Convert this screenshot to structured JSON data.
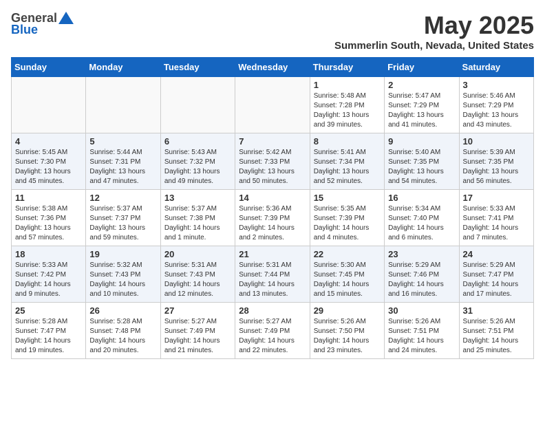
{
  "logo": {
    "general": "General",
    "blue": "Blue"
  },
  "title": "May 2025",
  "subtitle": "Summerlin South, Nevada, United States",
  "headers": [
    "Sunday",
    "Monday",
    "Tuesday",
    "Wednesday",
    "Thursday",
    "Friday",
    "Saturday"
  ],
  "weeks": [
    [
      {
        "day": "",
        "info": ""
      },
      {
        "day": "",
        "info": ""
      },
      {
        "day": "",
        "info": ""
      },
      {
        "day": "",
        "info": ""
      },
      {
        "day": "1",
        "info": "Sunrise: 5:48 AM\nSunset: 7:28 PM\nDaylight: 13 hours\nand 39 minutes."
      },
      {
        "day": "2",
        "info": "Sunrise: 5:47 AM\nSunset: 7:29 PM\nDaylight: 13 hours\nand 41 minutes."
      },
      {
        "day": "3",
        "info": "Sunrise: 5:46 AM\nSunset: 7:29 PM\nDaylight: 13 hours\nand 43 minutes."
      }
    ],
    [
      {
        "day": "4",
        "info": "Sunrise: 5:45 AM\nSunset: 7:30 PM\nDaylight: 13 hours\nand 45 minutes."
      },
      {
        "day": "5",
        "info": "Sunrise: 5:44 AM\nSunset: 7:31 PM\nDaylight: 13 hours\nand 47 minutes."
      },
      {
        "day": "6",
        "info": "Sunrise: 5:43 AM\nSunset: 7:32 PM\nDaylight: 13 hours\nand 49 minutes."
      },
      {
        "day": "7",
        "info": "Sunrise: 5:42 AM\nSunset: 7:33 PM\nDaylight: 13 hours\nand 50 minutes."
      },
      {
        "day": "8",
        "info": "Sunrise: 5:41 AM\nSunset: 7:34 PM\nDaylight: 13 hours\nand 52 minutes."
      },
      {
        "day": "9",
        "info": "Sunrise: 5:40 AM\nSunset: 7:35 PM\nDaylight: 13 hours\nand 54 minutes."
      },
      {
        "day": "10",
        "info": "Sunrise: 5:39 AM\nSunset: 7:35 PM\nDaylight: 13 hours\nand 56 minutes."
      }
    ],
    [
      {
        "day": "11",
        "info": "Sunrise: 5:38 AM\nSunset: 7:36 PM\nDaylight: 13 hours\nand 57 minutes."
      },
      {
        "day": "12",
        "info": "Sunrise: 5:37 AM\nSunset: 7:37 PM\nDaylight: 13 hours\nand 59 minutes."
      },
      {
        "day": "13",
        "info": "Sunrise: 5:37 AM\nSunset: 7:38 PM\nDaylight: 14 hours\nand 1 minute."
      },
      {
        "day": "14",
        "info": "Sunrise: 5:36 AM\nSunset: 7:39 PM\nDaylight: 14 hours\nand 2 minutes."
      },
      {
        "day": "15",
        "info": "Sunrise: 5:35 AM\nSunset: 7:39 PM\nDaylight: 14 hours\nand 4 minutes."
      },
      {
        "day": "16",
        "info": "Sunrise: 5:34 AM\nSunset: 7:40 PM\nDaylight: 14 hours\nand 6 minutes."
      },
      {
        "day": "17",
        "info": "Sunrise: 5:33 AM\nSunset: 7:41 PM\nDaylight: 14 hours\nand 7 minutes."
      }
    ],
    [
      {
        "day": "18",
        "info": "Sunrise: 5:33 AM\nSunset: 7:42 PM\nDaylight: 14 hours\nand 9 minutes."
      },
      {
        "day": "19",
        "info": "Sunrise: 5:32 AM\nSunset: 7:43 PM\nDaylight: 14 hours\nand 10 minutes."
      },
      {
        "day": "20",
        "info": "Sunrise: 5:31 AM\nSunset: 7:43 PM\nDaylight: 14 hours\nand 12 minutes."
      },
      {
        "day": "21",
        "info": "Sunrise: 5:31 AM\nSunset: 7:44 PM\nDaylight: 14 hours\nand 13 minutes."
      },
      {
        "day": "22",
        "info": "Sunrise: 5:30 AM\nSunset: 7:45 PM\nDaylight: 14 hours\nand 15 minutes."
      },
      {
        "day": "23",
        "info": "Sunrise: 5:29 AM\nSunset: 7:46 PM\nDaylight: 14 hours\nand 16 minutes."
      },
      {
        "day": "24",
        "info": "Sunrise: 5:29 AM\nSunset: 7:47 PM\nDaylight: 14 hours\nand 17 minutes."
      }
    ],
    [
      {
        "day": "25",
        "info": "Sunrise: 5:28 AM\nSunset: 7:47 PM\nDaylight: 14 hours\nand 19 minutes."
      },
      {
        "day": "26",
        "info": "Sunrise: 5:28 AM\nSunset: 7:48 PM\nDaylight: 14 hours\nand 20 minutes."
      },
      {
        "day": "27",
        "info": "Sunrise: 5:27 AM\nSunset: 7:49 PM\nDaylight: 14 hours\nand 21 minutes."
      },
      {
        "day": "28",
        "info": "Sunrise: 5:27 AM\nSunset: 7:49 PM\nDaylight: 14 hours\nand 22 minutes."
      },
      {
        "day": "29",
        "info": "Sunrise: 5:26 AM\nSunset: 7:50 PM\nDaylight: 14 hours\nand 23 minutes."
      },
      {
        "day": "30",
        "info": "Sunrise: 5:26 AM\nSunset: 7:51 PM\nDaylight: 14 hours\nand 24 minutes."
      },
      {
        "day": "31",
        "info": "Sunrise: 5:26 AM\nSunset: 7:51 PM\nDaylight: 14 hours\nand 25 minutes."
      }
    ]
  ]
}
